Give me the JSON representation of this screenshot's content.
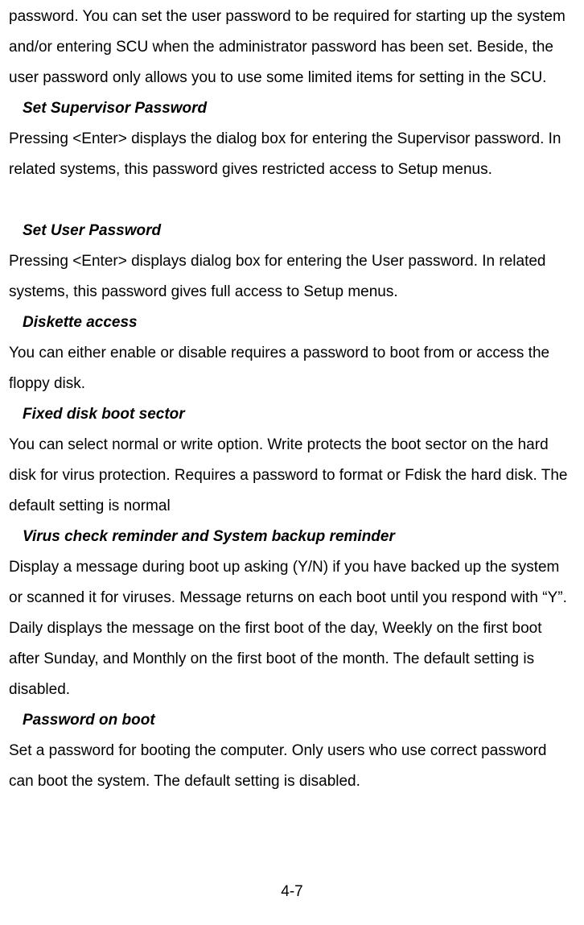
{
  "sections": {
    "intro_body": "password. You can set the user password to be required for starting up the system and/or entering SCU when the administrator password has been set. Beside, the user password only allows you to use some limited items for setting in the SCU.",
    "s1_head": "Set Supervisor Password",
    "s1_body": "Pressing <Enter> displays the dialog box for entering the Supervisor password. In related systems, this password gives restricted access to Setup menus.",
    "s2_head": "Set User Password",
    "s2_body": "Pressing <Enter> displays dialog box for entering the User password. In related systems, this password gives full access to Setup menus.",
    "s3_head": "Diskette access",
    "s3_body": "You can either enable or disable requires a password to boot from or access the floppy disk.",
    "s4_head": "Fixed disk boot sector",
    "s4_body": "You can select normal or write option. Write protects the boot sector on the hard disk for virus protection. Requires a password to format or Fdisk the hard disk. The default setting is normal",
    "s5_head": "Virus check reminder and System backup reminder",
    "s5_body1": "Display a message during boot up asking (Y/N) if you have backed up the system or scanned it for viruses. Message returns on each boot until you respond with “Y”.",
    "s5_body2": "Daily displays the message on the first boot of the day, Weekly on the first boot after Sunday, and Monthly on the first boot of the month. The default setting is disabled.",
    "s6_head": "Password on boot",
    "s6_body": "Set a password for booting the computer. Only users who use correct password can boot the system. The default setting is disabled."
  },
  "page_number": "4-7"
}
